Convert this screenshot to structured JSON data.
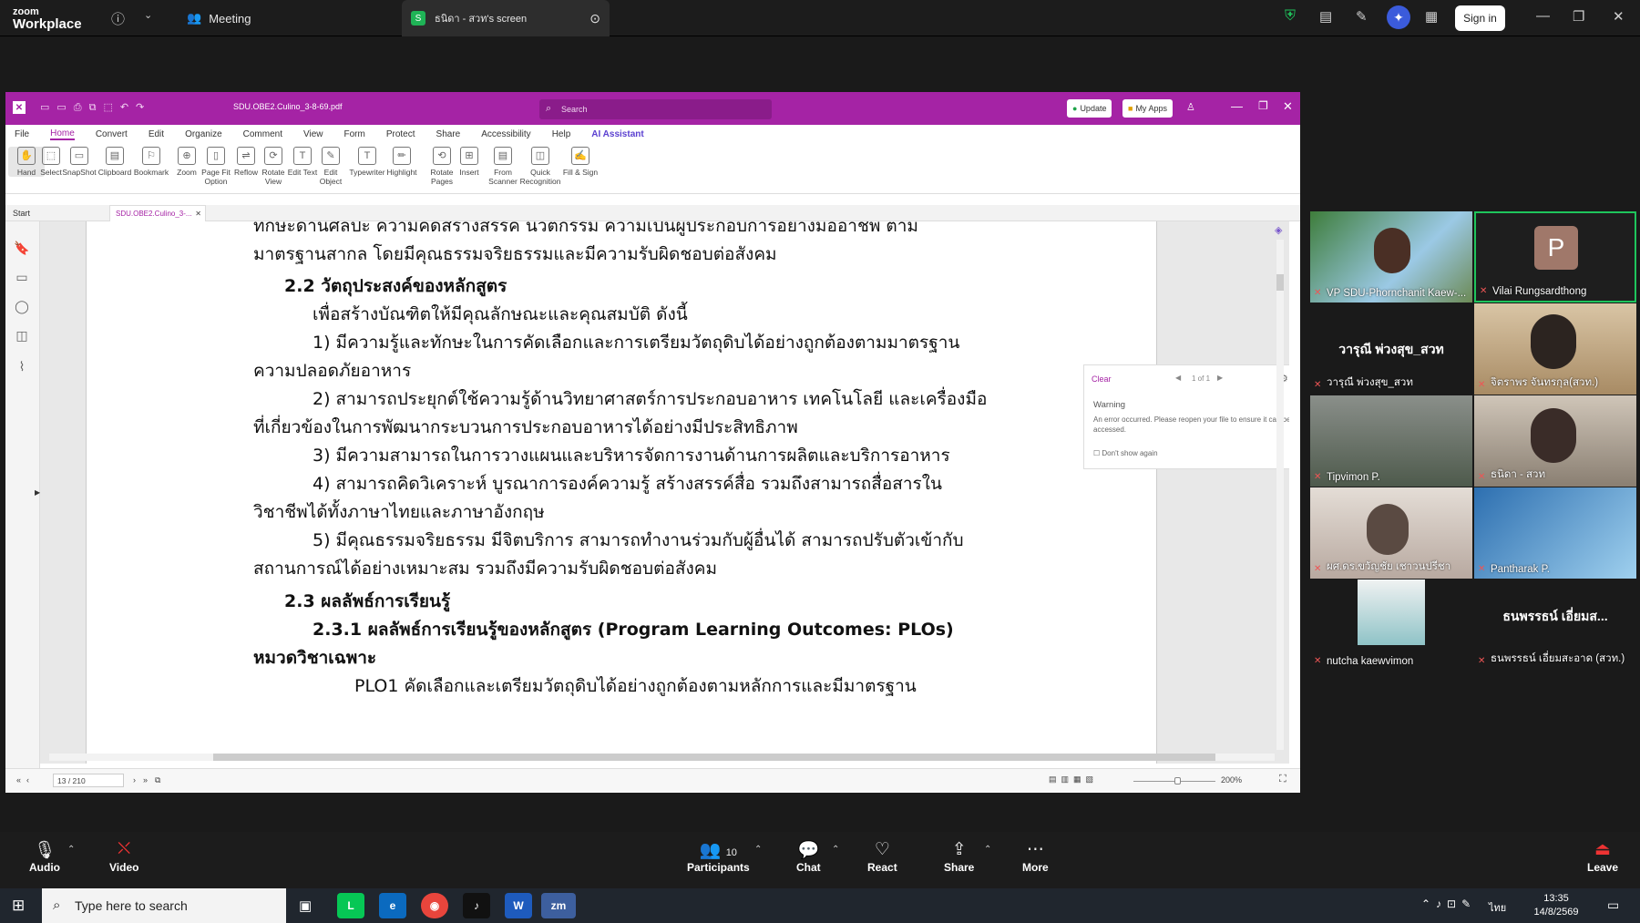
{
  "zoom": {
    "logo_line1": "zoom",
    "logo_line2": "Workplace",
    "meeting_label": "Meeting",
    "share_title": "ธนิดา - สวท's screen",
    "sign_in": "Sign in"
  },
  "pdf": {
    "filename": "SDU.OBE2.Culino_3-8-69.pdf",
    "search_placeholder": "Search",
    "update": "Update",
    "my_apps": "My Apps",
    "menu": [
      "File",
      "Home",
      "Convert",
      "Edit",
      "Organize",
      "Comment",
      "View",
      "Form",
      "Protect",
      "Share",
      "Accessibility",
      "Help",
      "AI Assistant"
    ],
    "ribbon": [
      "Hand",
      "Select",
      "SnapShot",
      "Clipboard",
      "Bookmark",
      "Zoom",
      "Page Fit Option",
      "Reflow",
      "Rotate View",
      "Edit Text",
      "Edit Object",
      "Typewriter",
      "Highlight",
      "Rotate Pages",
      "Insert",
      "From Scanner",
      "Quick Recognition",
      "Fill & Sign"
    ],
    "tab_start": "Start",
    "tab_doc": "SDU.OBE2.Culino_3-...",
    "page_lines": [
      "ทักษะด้านศิลปะ ความคิดสร้างสรรค์ นวัตกรรม ความเป็นผู้ประกอบการอย่างมืออาชีพ ตาม",
      "มาตรฐานสากล โดยมีคุณธรรมจริยธรรมและมีความรับผิดชอบต่อสังคม",
      "2.2 วัตถุประสงค์ของหลักสูตร",
      "เพื่อสร้างบัณฑิตให้มีคุณลักษณะและคุณสมบัติ ดังนี้",
      "1) มีความรู้และทักษะในการคัดเลือกและการเตรียมวัตถุดิบได้อย่างถูกต้องตามมาตรฐาน",
      "ความปลอดภัยอาหาร",
      "2) สามารถประยุกต์ใช้ความรู้ด้านวิทยาศาสตร์การประกอบอาหาร เทคโนโลยี และเครื่องมือ",
      "ที่เกี่ยวข้องในการพัฒนากระบวนการประกอบอาหารได้อย่างมีประสิทธิภาพ",
      "3) มีความสามารถในการวางแผนและบริหารจัดการงานด้านการผลิตและบริการอาหาร",
      "4) สามารถคิดวิเคราะห์ บูรณาการองค์ความรู้ สร้างสรรค์สื่อ รวมถึงสามารถสื่อสารใน",
      "วิชาชีพได้ทั้งภาษาไทยและภาษาอังกฤษ",
      "5) มีคุณธรรมจริยธรรม มีจิตบริการ สามารถทำงานร่วมกับผู้อื่นได้ สามารถปรับตัวเข้ากับ",
      "สถานการณ์ได้อย่างเหมาะสม รวมถึงมีความรับผิดชอบต่อสังคม",
      "2.3 ผลลัพธ์การเรียนรู้",
      "2.3.1 ผลลัพธ์การเรียนรู้ของหลักสูตร (Program Learning Outcomes: PLOs)",
      "หมวดวิชาเฉพาะ",
      "PLO1 คัดเลือกและเตรียมวัตถุดิบได้อย่างถูกต้องตามหลักการและมีมาตรฐาน"
    ],
    "warning": {
      "clear": "Clear",
      "count": "1 of 1",
      "title": "Warning",
      "message": "An error occurred. Please reopen your file to ensure it can be accessed.",
      "dont_show": "Don't show again"
    },
    "page_indicator": "13 / 210",
    "zoom_level": "200%"
  },
  "participants": [
    {
      "name": "VP SDU-Phornchanit Kaew-..."
    },
    {
      "name": "Vilai Rungsardthong",
      "initial": "P"
    },
    {
      "name": "วารุณี พ่วงสุข_สวท",
      "big": "วารุณี พ่วงสุข_สวท"
    },
    {
      "name": "จิตราพร จันทรกุล(สวท.)"
    },
    {
      "name": "Tipvimon P."
    },
    {
      "name": "ธนิดา - สวท"
    },
    {
      "name": "ผศ.ดร.ขวัญชัย เชาวนปรีชา"
    },
    {
      "name": "Pantharak P."
    },
    {
      "name": "nutcha kaewvimon"
    },
    {
      "name": "ธนพรรธน์ เอี่ยมสะอาด (สวท.)",
      "big": "ธนพรรธน์ เอี่ยมส..."
    }
  ],
  "controls": {
    "audio": "Audio",
    "video": "Video",
    "participants": "Participants",
    "participant_count": "10",
    "chat": "Chat",
    "react": "React",
    "share": "Share",
    "more": "More",
    "leave": "Leave"
  },
  "taskbar": {
    "search": "Type here to search",
    "time": "13:35",
    "date": "14/8/2569",
    "lang": "ไทย"
  }
}
